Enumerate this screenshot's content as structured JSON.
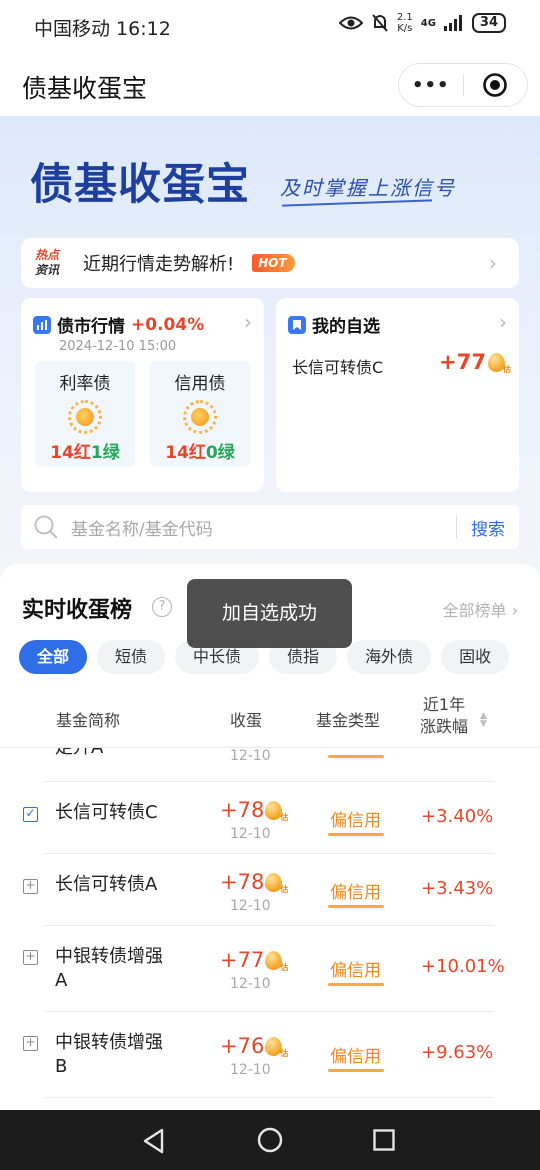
{
  "status_bar": {
    "carrier_time": "中国移动 16:12",
    "net_speed_top": "2.1",
    "net_speed_unit": "K/s",
    "network": "4G",
    "battery": "34"
  },
  "header": {
    "title": "债基收蛋宝",
    "more_label": "•••"
  },
  "banner": {
    "logo": "债基收蛋宝",
    "slogan": "及时掌握上涨信号"
  },
  "hot_news": {
    "tag_top": "热点",
    "tag_bottom": "资讯",
    "text": "近期行情走势解析!",
    "badge": "HOT"
  },
  "market_card": {
    "title": "债市行情",
    "change": "+0.04%",
    "time": "2024-12-10 15:00",
    "rate_bond": {
      "name": "利率债",
      "red": "14红",
      "green": "1绿"
    },
    "credit_bond": {
      "name": "信用债",
      "red": "14红",
      "green": "0绿"
    }
  },
  "watch_card": {
    "title": "我的自选",
    "item_name": "长信可转债C",
    "item_value": "+77"
  },
  "search": {
    "placeholder": "基金名称/基金代码",
    "button": "搜索"
  },
  "ranking": {
    "title": "实时收蛋榜",
    "help": "?",
    "all_label": "全部榜单",
    "filters": [
      "全部",
      "短债",
      "中长债",
      "债指",
      "海外债",
      "固收"
    ],
    "columns": {
      "name": "基金简称",
      "eggs": "收蛋",
      "type": "基金类型",
      "perf_line1": "近1年",
      "perf_line2": "涨跌幅"
    },
    "rows": [
      {
        "name": "走升A",
        "value": "",
        "date": "12-10",
        "type": "",
        "perf": "",
        "checked": false
      },
      {
        "name": "长信可转债C",
        "value": "+78",
        "date": "12-10",
        "type": "偏信用",
        "perf": "+3.40%",
        "checked": true
      },
      {
        "name": "长信可转债A",
        "value": "+78",
        "date": "12-10",
        "type": "偏信用",
        "perf": "+3.43%",
        "checked": false
      },
      {
        "name": "中银转债增强A",
        "value": "+77",
        "date": "12-10",
        "type": "偏信用",
        "perf": "+10.01%",
        "checked": false
      },
      {
        "name": "中银转债增强B",
        "value": "+76",
        "date": "12-10",
        "type": "偏信用",
        "perf": "+9.63%",
        "checked": false
      }
    ]
  },
  "toast": {
    "message": "加自选成功"
  },
  "colors": {
    "accent_blue": "#2f6ee6",
    "up_red": "#e8462b",
    "down_green": "#27a859",
    "type_orange": "#f08a1e"
  }
}
